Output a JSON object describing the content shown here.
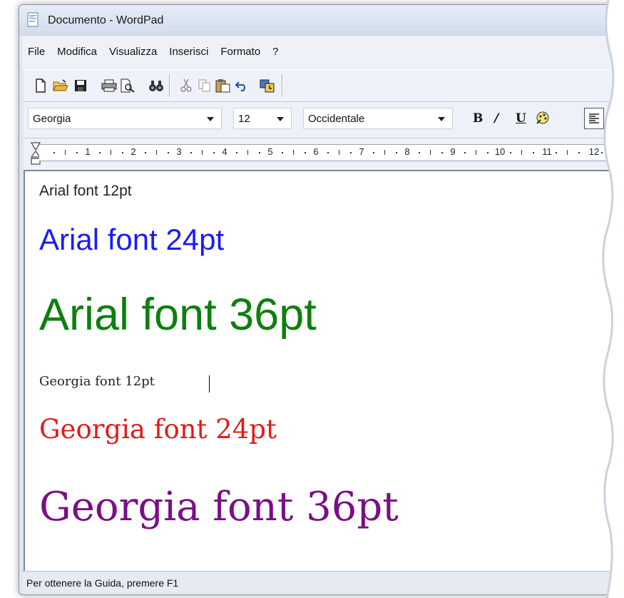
{
  "window": {
    "title": "Documento - WordPad"
  },
  "menu": [
    "File",
    "Modifica",
    "Visualizza",
    "Inserisci",
    "Formato",
    "?"
  ],
  "toolbar": {
    "icons": [
      "new-document-icon",
      "open-folder-icon",
      "save-icon",
      "print-icon",
      "print-preview-icon",
      "find-icon",
      "cut-icon",
      "copy-icon",
      "paste-icon",
      "undo-icon",
      "insert-date-time-icon"
    ]
  },
  "format": {
    "font": "Georgia",
    "size": "12",
    "script": "Occidentale",
    "bold_label": "B",
    "italic_label": "/",
    "underline_label": "U"
  },
  "ruler": {
    "marks": [
      "1",
      "2",
      "3",
      "4",
      "5",
      "6",
      "7",
      "8",
      "9",
      "10",
      "11",
      "12"
    ]
  },
  "document": {
    "lines": [
      {
        "text": "Arial font 12pt",
        "color": "#222222"
      },
      {
        "text": "Arial font 24pt",
        "color": "#1a1aff"
      },
      {
        "text": "Arial font 36pt",
        "color": "#0d7f0d"
      },
      {
        "text": "Georgia font 12pt",
        "color": "#222222"
      },
      {
        "text": "Georgia font 24pt",
        "color": "#e21a1a"
      },
      {
        "text": "Georgia font 36pt",
        "color": "#7a0f86"
      }
    ]
  },
  "status": {
    "text": "Per ottenere la Guida, premere F1"
  }
}
